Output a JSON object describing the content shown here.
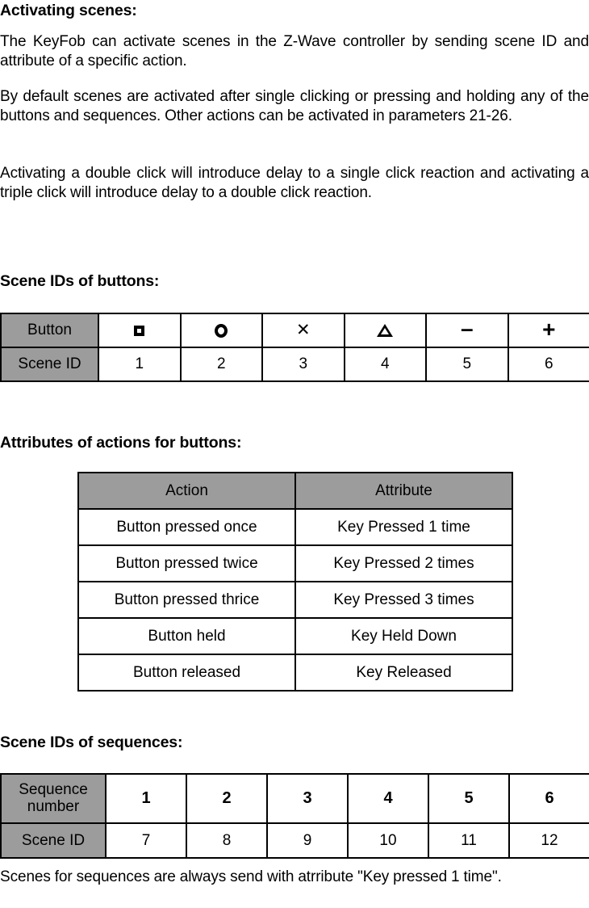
{
  "document": {
    "sections": [
      {
        "heading": "Activating scenes:",
        "paragraphs": [
          "The KeyFob can activate scenes in the Z-Wave controller by sending scene ID and attribute of a specific action.",
          "By default scenes are activated after single clicking or pressing and holding any of the buttons and sequences. Other actions can be activated in parameters 21-26.",
          "Activating a double click will introduce delay to a single click reaction and activating a triple click will introduce delay to a double click reaction."
        ]
      }
    ],
    "headings": {
      "buttons_table": "Scene IDs of buttons:",
      "attributes_table": "Attributes of actions for buttons:",
      "sequences_table": "Scene IDs of sequences:"
    },
    "closing_paragraph": "Scenes for sequences are always send with atrribute \"Key pressed 1 time\"."
  },
  "colors": {
    "header_gray": "#9c9c9c",
    "border": "#000000",
    "text": "#000000",
    "background": "#ffffff"
  },
  "buttons_table": {
    "row_labels": [
      "Button",
      "Scene ID"
    ],
    "button_icons": [
      "square-icon",
      "circle-icon",
      "cross-icon",
      "triangle-icon",
      "minus-icon",
      "plus-icon"
    ],
    "button_glyphs": [
      "□",
      "○",
      "✕",
      "△",
      "–",
      "+"
    ],
    "scene_ids": [
      "1",
      "2",
      "3",
      "4",
      "5",
      "6"
    ]
  },
  "attributes_table": {
    "columns": [
      "Action",
      "Attribute"
    ],
    "rows": [
      {
        "action": "Button pressed once",
        "attribute": "Key Pressed 1 time"
      },
      {
        "action": "Button pressed twice",
        "attribute": "Key Pressed 2 times"
      },
      {
        "action": "Button pressed thrice",
        "attribute": "Key Pressed 3 times"
      },
      {
        "action": "Button held",
        "attribute": "Key Held Down"
      },
      {
        "action": "Button released",
        "attribute": "Key Released"
      }
    ]
  },
  "sequences_table": {
    "row_labels": {
      "sequence_number_line1": "Sequence",
      "sequence_number_line2": "number",
      "scene_id": "Scene ID"
    },
    "sequence_numbers": [
      "1",
      "2",
      "3",
      "4",
      "5",
      "6"
    ],
    "scene_ids": [
      "7",
      "8",
      "9",
      "10",
      "11",
      "12"
    ]
  }
}
